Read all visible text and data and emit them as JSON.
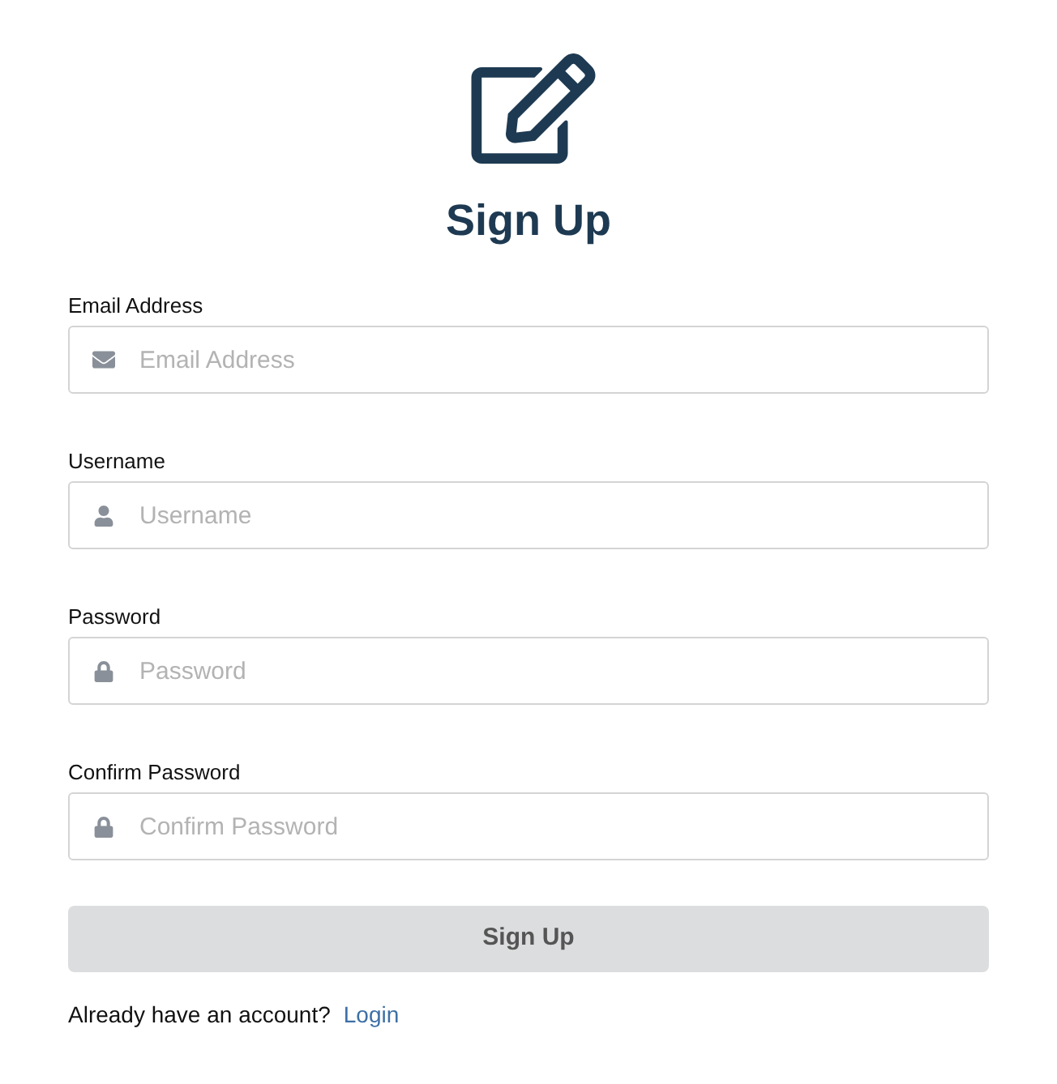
{
  "title": "Sign Up",
  "fields": [
    {
      "kind": "email",
      "label": "Email Address",
      "placeholder": "Email Address"
    },
    {
      "kind": "user",
      "label": "Username",
      "placeholder": "Username"
    },
    {
      "kind": "lock",
      "label": "Password",
      "placeholder": "Password"
    },
    {
      "kind": "lock",
      "label": "Confirm Password",
      "placeholder": "Confirm Password"
    }
  ],
  "submit": {
    "label": "Sign Up",
    "disabled": true
  },
  "footer": {
    "text": "Already have an account?",
    "link": "Login"
  }
}
